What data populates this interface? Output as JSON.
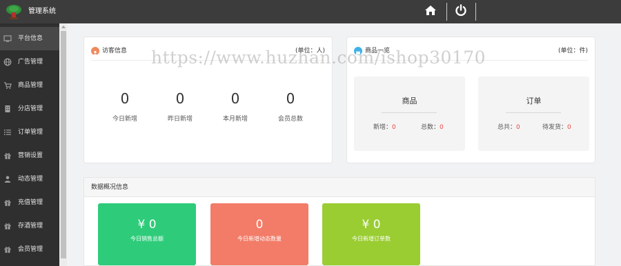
{
  "header": {
    "title": "管理系统",
    "logo_icon": "tree-logo-icon",
    "home_icon": "home-icon",
    "power_icon": "power-icon",
    "background_color": "#3c3c3c"
  },
  "sidebar": {
    "items": [
      {
        "label": "平台信息",
        "icon": "monitor-icon",
        "active": true
      },
      {
        "label": "广告管理",
        "icon": "globe-icon"
      },
      {
        "label": "商品管理",
        "icon": "cart-icon"
      },
      {
        "label": "分店管理",
        "icon": "building-icon"
      },
      {
        "label": "订单管理",
        "icon": "list-icon"
      },
      {
        "label": "营销设置",
        "icon": "gift-icon"
      },
      {
        "label": "动态管理",
        "icon": "user-icon"
      },
      {
        "label": "充值管理",
        "icon": "gift-icon"
      },
      {
        "label": "存酒管理",
        "icon": "gift-icon"
      },
      {
        "label": "会员管理",
        "icon": "gift-icon"
      }
    ]
  },
  "visitor_panel": {
    "title": "访客信息",
    "unit": "(单位：人)",
    "icon_color": "#f08a5d",
    "stats": [
      {
        "value": "0",
        "label": "今日新增"
      },
      {
        "value": "0",
        "label": "昨日新增"
      },
      {
        "value": "0",
        "label": "本月新增"
      },
      {
        "value": "0",
        "label": "会员总数"
      }
    ]
  },
  "goods_panel": {
    "title": "商品一览",
    "unit": "(单位：件)",
    "icon_color": "#3fb0e8",
    "cards": [
      {
        "title": "商品",
        "left_label": "新增：",
        "left_value": "0",
        "right_label": "总数：",
        "right_value": "0"
      },
      {
        "title": "订单",
        "left_label": "总共：",
        "left_value": "0",
        "right_label": "待发货：",
        "right_value": "0"
      }
    ]
  },
  "overview": {
    "title": "数据概况信息",
    "tiles": [
      {
        "value": "¥ 0",
        "label": "今日销售总额",
        "color": "#2ecc7a"
      },
      {
        "value": "0",
        "label": "今日新增动态数量",
        "color": "#f27c68"
      },
      {
        "value": "¥ 0",
        "label": "今日新增订单数",
        "color": "#9acd32"
      }
    ]
  },
  "watermark": "https://www.huzhan.com/ishop30170"
}
